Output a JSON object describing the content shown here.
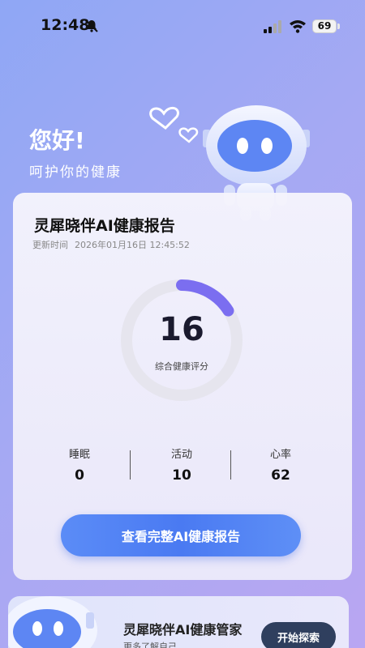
{
  "status_bar": {
    "time": "12:48",
    "battery": "69",
    "icons": [
      "bell-off-icon",
      "signal-icon",
      "wifi-icon",
      "battery-icon"
    ]
  },
  "header": {
    "greeting": "您好!",
    "subtitle": "呵护你的健康",
    "mascot_icon": "robot-mascot-with-hearts"
  },
  "report": {
    "title": "灵犀晓伴AI健康报告",
    "update_label": "更新时间",
    "update_time": "2026年01月16日 12:45:52",
    "score": "16",
    "score_fraction": 0.16,
    "score_label": "综合健康评分",
    "metrics": [
      {
        "label": "睡眠",
        "value": "0"
      },
      {
        "label": "活动",
        "value": "10"
      },
      {
        "label": "心率",
        "value": "62"
      }
    ],
    "cta_label": "查看完整AI健康报告"
  },
  "assistant": {
    "title": "灵犀晓伴AI健康管家",
    "subtitle": "更多了解自己",
    "button_label": "开始探索"
  },
  "colors": {
    "accent": "#4a7af2",
    "ring_progress": "#7b6ef0",
    "ring_track": "#e6e5ee",
    "dark_button": "#2f3f5e"
  }
}
